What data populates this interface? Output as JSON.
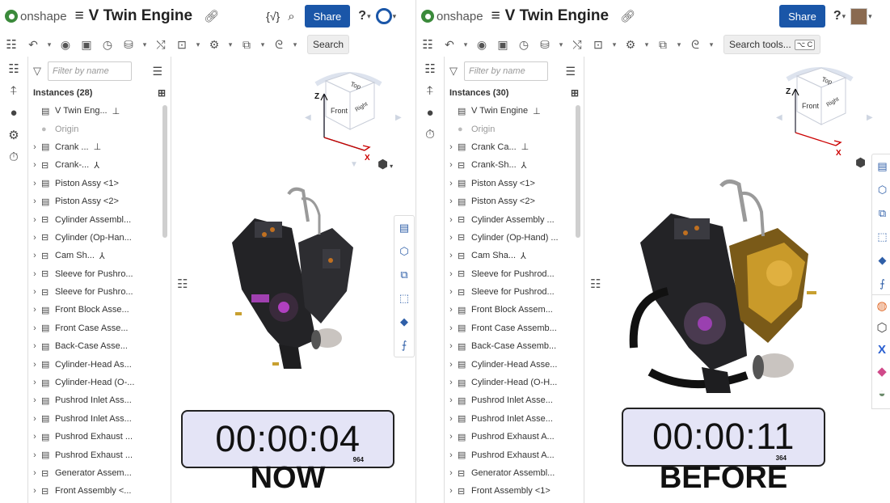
{
  "app_name": "onshape",
  "doc_title": "V Twin Engine",
  "share_label": "Share",
  "braces_icon": "{√}",
  "toolbar": {
    "search_label": "Search",
    "search_tools_label": "Search tools...",
    "search_tools_kbd": "⌥ C"
  },
  "filter_placeholder": "Filter by name",
  "left": {
    "instances_header": "Instances (28)",
    "items": [
      "V Twin Eng...",
      "Origin",
      "Crank ...",
      "Crank-...",
      "Piston Assy <1>",
      "Piston Assy <2>",
      "Cylinder Assembl...",
      "Cylinder (Op-Han...",
      "Cam Sh...",
      "Sleeve for Pushro...",
      "Sleeve for Pushro...",
      "Front Block Asse...",
      "Front Case Asse...",
      "Back-Case Asse...",
      "Cylinder-Head As...",
      "Cylinder-Head (O-...",
      "Pushrod Inlet Ass...",
      "Pushrod Inlet Ass...",
      "Pushrod Exhaust ...",
      "Pushrod Exhaust ...",
      "Generator Assem...",
      "Front Assembly <..."
    ],
    "timer": "00:00:04",
    "timer_ms": "964",
    "caption": "NOW"
  },
  "right": {
    "instances_header": "Instances (30)",
    "items": [
      "V Twin Engine",
      "Origin",
      "Crank Ca...",
      "Crank-Sh...",
      "Piston Assy <1>",
      "Piston Assy <2>",
      "Cylinder Assembly ...",
      "Cylinder (Op-Hand) ...",
      "Cam Sha...",
      "Sleeve for Pushrod...",
      "Sleeve for Pushrod...",
      "Front Block Assem...",
      "Front Case Assemb...",
      "Back-Case Assemb...",
      "Cylinder-Head Asse...",
      "Cylinder-Head (O-H...",
      "Pushrod Inlet Asse...",
      "Pushrod Inlet Asse...",
      "Pushrod Exhaust A...",
      "Pushrod Exhaust A...",
      "Generator Assembl...",
      "Front Assembly <1>"
    ],
    "timer": "00:00:11",
    "timer_ms": "364",
    "caption": "BEFORE"
  },
  "viewcube": {
    "top": "Top",
    "front": "Front",
    "right": "Right",
    "axis_z": "Z",
    "axis_x": "X"
  },
  "colors": {
    "share": "#1a56a8",
    "logo": "#3b8a3b",
    "timer_bg": "#e4e4f6"
  }
}
